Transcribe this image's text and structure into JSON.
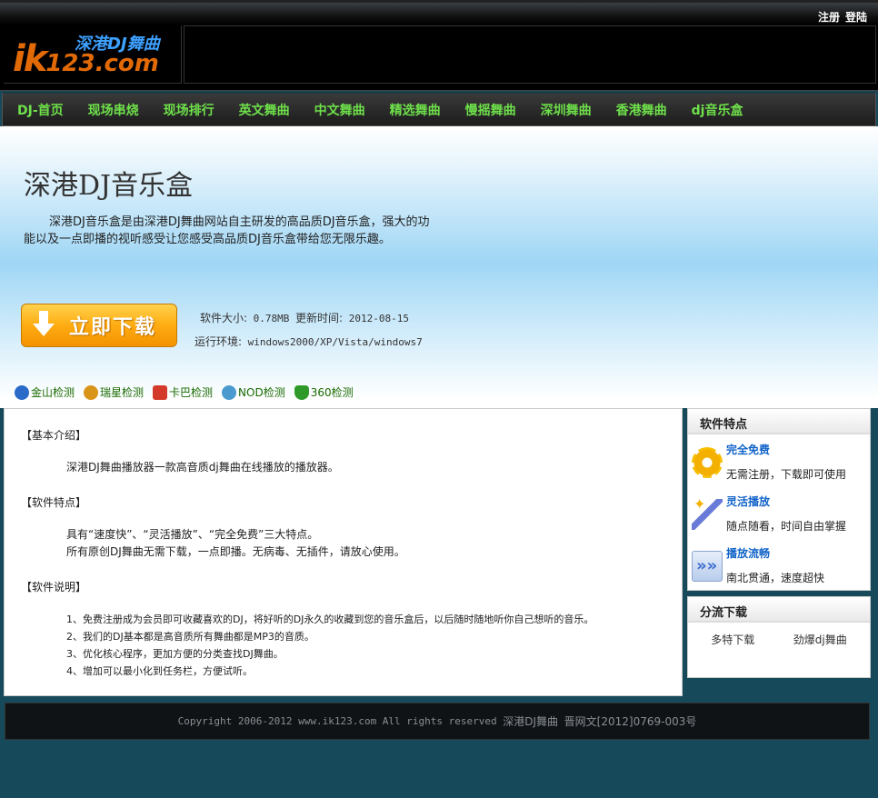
{
  "topbar": {
    "register": "注册",
    "login": "登陆"
  },
  "logo": {
    "main": "ik",
    "suffix": "123.com",
    "tagline": "深港DJ舞曲"
  },
  "nav": [
    "DJ-首页",
    "现场串烧",
    "现场排行",
    "英文舞曲",
    "中文舞曲",
    "精选舞曲",
    "慢摇舞曲",
    "深圳舞曲",
    "香港舞曲",
    "dj音乐盒"
  ],
  "hero": {
    "title": "深港DJ音乐盒",
    "description": "深港DJ音乐盒是由深港DJ舞曲网站自主研发的高品质DJ音乐盒，强大的功能以及一点即播的视听感受让您感受高品质DJ音乐盒带给您无限乐趣。",
    "download_label": "立即下载",
    "size_label": "软件大小:",
    "size_value": "0.78MB",
    "update_label": "更新时间:",
    "update_value": "2012-08-15",
    "env_label": "运行环境:",
    "env_value": "windows2000/XP/Vista/windows7"
  },
  "checks": [
    "金山检测",
    "瑞星检测",
    "卡巴检测",
    "NOD检测",
    "360检测"
  ],
  "content": {
    "basic_title": "【基本介绍】",
    "basic_text": "深港DJ舞曲播放器一款高音质dj舞曲在线播放的播放器。",
    "feature_title": "【软件特点】",
    "feature_lines": [
      "具有“速度快”、“灵活播放”、“完全免费”三大特点。",
      "所有原创DJ舞曲无需下载，一点即播。无病毒、无插件，请放心使用。"
    ],
    "desc_title": "【软件说明】",
    "desc_lines": [
      "1、免费注册成为会员即可收藏喜欢的DJ，将好听的DJ永久的收藏到您的音乐盒后，以后随时随地听你自己想听的音乐。",
      "2、我们的DJ基本都是高音质所有舞曲都是MP3的音质。",
      "3、优化核心程序，更加方便的分类查找DJ舞曲。",
      "4、增加可以最小化到任务栏，方便试听。"
    ]
  },
  "sidebar": {
    "features_title": "软件特点",
    "features": [
      {
        "title": "完全免费",
        "desc": "无需注册，下载即可使用",
        "icon": "gear-icon"
      },
      {
        "title": "灵活播放",
        "desc": "随点随看，时间自由掌握",
        "icon": "wand-icon"
      },
      {
        "title": "播放流畅",
        "desc": "南北贯通，速度超快",
        "icon": "arrows-icon"
      }
    ],
    "downloads_title": "分流下载",
    "downloads": [
      "多特下载",
      "劲爆dj舞曲"
    ]
  },
  "footer": {
    "copyright": "Copyright 2006-2012 www.ik123.com All rights reserved",
    "site": "深港DJ舞曲",
    "icp": "晋网文[2012]0769-003号"
  }
}
